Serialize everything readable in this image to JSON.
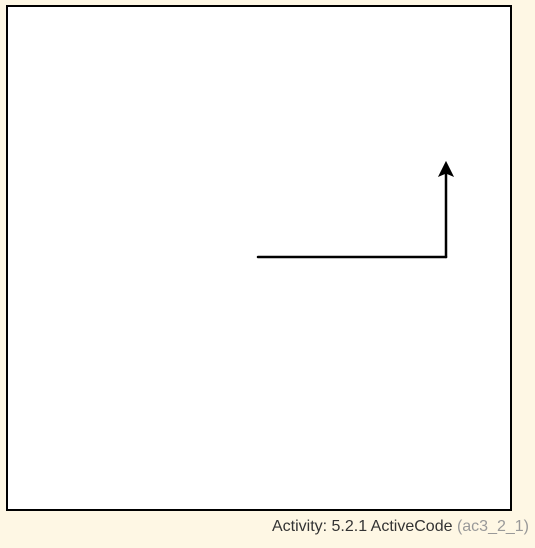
{
  "caption": {
    "label": "Activity: 5.2.1 ActiveCode",
    "id": "(ac3_2_1)"
  },
  "colors": {
    "page_background": "#fef7e4",
    "canvas_background": "#ffffff",
    "border": "#000000",
    "drawing": "#000000",
    "caption_text": "#333333",
    "caption_id_text": "#999999"
  },
  "turtle": {
    "icon": "turtle-arrow-icon",
    "heading": "up"
  }
}
